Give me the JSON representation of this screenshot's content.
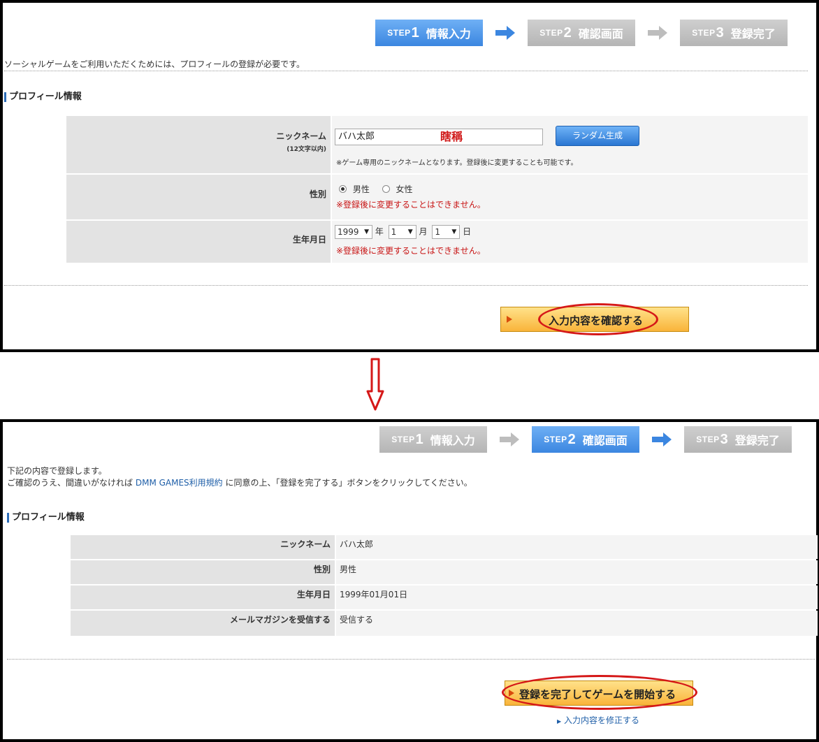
{
  "steps": [
    {
      "word": "STEP",
      "num": "1",
      "label": "情報入力"
    },
    {
      "word": "STEP",
      "num": "2",
      "label": "確認画面"
    },
    {
      "word": "STEP",
      "num": "3",
      "label": "登録完了"
    }
  ],
  "colors": {
    "active_step": "#3b86e0",
    "inactive_step": "#b5b5b5",
    "accent_blue": "#2b6cb8",
    "warning_red": "#c81414",
    "annotation_red": "#d51818"
  },
  "panel1": {
    "intro": "ソーシャルゲームをご利用いただくためには、プロフィールの登録が必要です。",
    "section_title": "プロフィール情報",
    "nickname_label": "ニックネーム",
    "nickname_limit": "(12文字以内)",
    "nickname_value": "バハ太郎",
    "nickname_annotation": "瞎稱",
    "random_button": "ランダム生成",
    "nickname_note": "※ゲーム専用のニックネームとなります。登録後に変更することも可能です。",
    "gender_label": "性別",
    "gender_male": "男性",
    "gender_female": "女性",
    "gender_warning": "※登録後に変更することはできません。",
    "birth_label": "生年月日",
    "birth_year": "1999",
    "year_unit": "年",
    "birth_month": "1",
    "month_unit": "月",
    "birth_day": "1",
    "day_unit": "日",
    "birth_warning": "※登録後に変更することはできません。",
    "confirm_button": "入力内容を確認する"
  },
  "panel2": {
    "intro_line1": "下記の内容で登録します。",
    "intro_line2_pre": "ご確認のうえ、間違いがなければ",
    "terms_link": "DMM GAMES利用規約",
    "intro_line2_post": "に同意の上、「登録を完了する」ボタンをクリックしてください。",
    "section_title": "プロフィール情報",
    "rows": [
      {
        "label": "ニックネーム",
        "value": "バハ太郎"
      },
      {
        "label": "性別",
        "value": "男性"
      },
      {
        "label": "生年月日",
        "value": "1999年01月01日"
      },
      {
        "label": "メールマガジンを受信する",
        "value": "受信する"
      }
    ],
    "complete_button": "登録を完了してゲームを開始する",
    "edit_link": "入力内容を修正する"
  }
}
